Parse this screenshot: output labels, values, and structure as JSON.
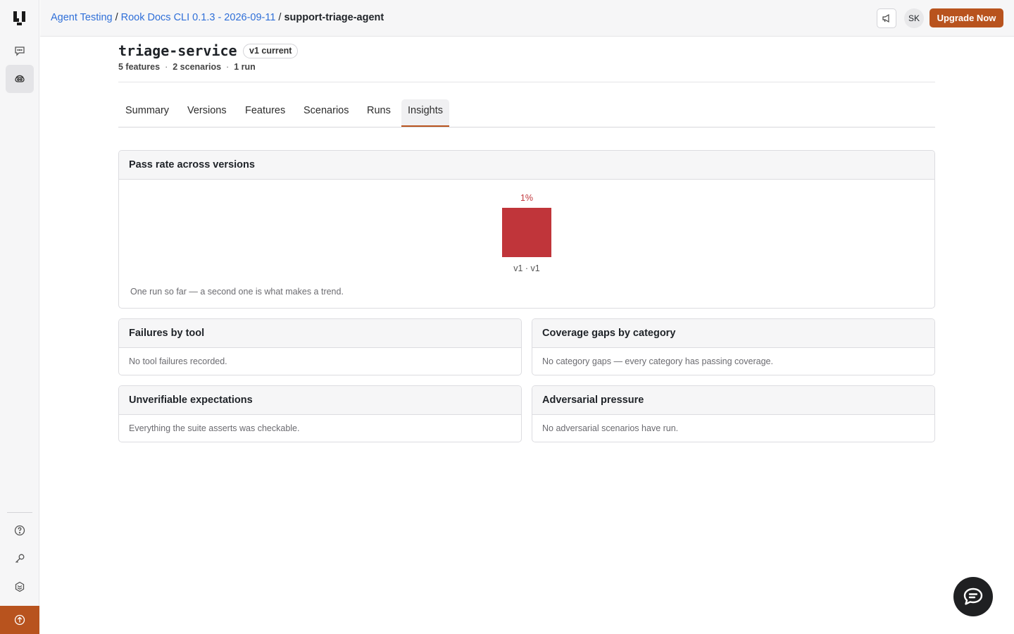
{
  "sidebar": {
    "logo": "brand-logo",
    "items": [
      {
        "name": "chat-icon",
        "active": false
      },
      {
        "name": "agent-testing-icon",
        "active": true
      }
    ],
    "bottom_items": [
      "help-icon",
      "key-icon",
      "settings-icon",
      "upgrade-arrow-icon"
    ]
  },
  "topbar": {
    "breadcrumb": {
      "crumb1": "Agent Testing",
      "crumb2": "Rook Docs CLI 0.1.3 - 2026-09-11",
      "current": "support-triage-agent",
      "separator": "/"
    },
    "avatar_initials": "SK",
    "upgrade_label": "Upgrade Now"
  },
  "header": {
    "title": "triage-service",
    "version_badge": "v1 current",
    "stats": {
      "features": "5 features",
      "scenarios": "2 scenarios",
      "runs": "1 run",
      "separator": "·"
    }
  },
  "tabs": [
    {
      "label": "Summary",
      "active": false
    },
    {
      "label": "Versions",
      "active": false
    },
    {
      "label": "Features",
      "active": false
    },
    {
      "label": "Scenarios",
      "active": false
    },
    {
      "label": "Runs",
      "active": false
    },
    {
      "label": "Insights",
      "active": true
    }
  ],
  "pass_rate_card": {
    "title": "Pass rate across versions",
    "note": "One run so far — a second one is what makes a trend."
  },
  "chart_data": {
    "type": "bar",
    "categories": [
      "v1 · v1"
    ],
    "values": [
      1
    ],
    "data_labels": [
      "1%"
    ],
    "bar_color": "#c0353a"
  },
  "cards": {
    "failures_by_tool": {
      "title": "Failures by tool",
      "body": "No tool failures recorded."
    },
    "coverage_gaps": {
      "title": "Coverage gaps by category",
      "body": "No category gaps — every category has passing coverage."
    },
    "unverifiable": {
      "title": "Unverifiable expectations",
      "body": "Everything the suite asserts was checkable."
    },
    "adversarial": {
      "title": "Adversarial pressure",
      "body": "No adversarial scenarios have run."
    }
  },
  "colors": {
    "accent": "#b8531e",
    "link": "#2f6fd8",
    "bar": "#c0353a"
  }
}
